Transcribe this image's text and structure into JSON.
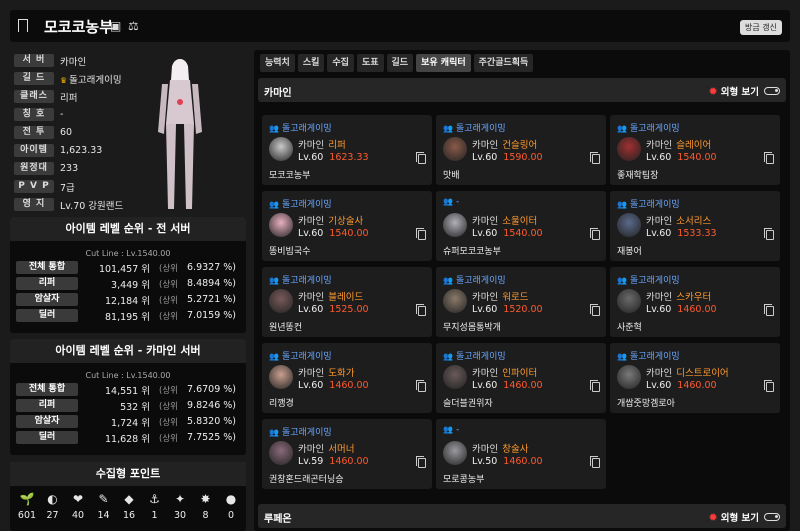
{
  "header": {
    "title": "모코코농부",
    "refresh_label": "방금 갱신"
  },
  "profile": {
    "rows": [
      {
        "label": "서 버",
        "value": "카마인"
      },
      {
        "label": "길 드",
        "value": "돌고래게이밍",
        "crown": true
      },
      {
        "label": "클래스",
        "value": "리퍼"
      },
      {
        "label": "칭 호",
        "value": "-"
      },
      {
        "label": "전 투",
        "value": "60"
      },
      {
        "label": "아이템",
        "value": "1,623.33"
      },
      {
        "label": "원정대",
        "value": "233"
      },
      {
        "label": "P V P",
        "value": "7급"
      },
      {
        "label": "영 지",
        "value": "Lv.70 강원랜드"
      }
    ]
  },
  "rank_all": {
    "title": "아이템 레벨 순위 - 전 서버",
    "cutline": "Cut Line : Lv.1540.00",
    "rows": [
      {
        "label": "전체 통합",
        "value": "101,457 위",
        "unit": "(상위",
        "pct": "6.9327 %)"
      },
      {
        "label": "리퍼",
        "value": "3,449 위",
        "unit": "(상위",
        "pct": "8.4894 %)"
      },
      {
        "label": "암살자",
        "value": "12,184 위",
        "unit": "(상위",
        "pct": "5.2721 %)"
      },
      {
        "label": "딜러",
        "value": "81,195 위",
        "unit": "(상위",
        "pct": "7.0159 %)"
      }
    ]
  },
  "rank_server": {
    "title": "아이템 레벨 순위 - 카마인 서버",
    "cutline": "Cut Line : Lv.1540.00",
    "rows": [
      {
        "label": "전체 통합",
        "value": "14,551 위",
        "unit": "(상위",
        "pct": "7.6709 %)"
      },
      {
        "label": "리퍼",
        "value": "532 위",
        "unit": "(상위",
        "pct": "9.8246 %)"
      },
      {
        "label": "암살자",
        "value": "1,724 위",
        "unit": "(상위",
        "pct": "5.8320 %)"
      },
      {
        "label": "딜러",
        "value": "11,628 위",
        "unit": "(상위",
        "pct": "7.7525 %)"
      }
    ]
  },
  "collection": {
    "title": "수집형 포인트",
    "items": [
      {
        "icon": "mokoko-seed-icon",
        "glyph": "🌱",
        "value": "601"
      },
      {
        "icon": "island-heart-icon",
        "glyph": "◐",
        "value": "27"
      },
      {
        "icon": "giant-heart-icon",
        "glyph": "❤",
        "value": "40"
      },
      {
        "icon": "art-icon",
        "glyph": "✎",
        "value": "14"
      },
      {
        "icon": "ignea-token-icon",
        "glyph": "◆",
        "value": "16"
      },
      {
        "icon": "voyage-icon",
        "glyph": "⚓",
        "value": "1"
      },
      {
        "icon": "world-tree-leaf-icon",
        "glyph": "✦",
        "value": "30"
      },
      {
        "icon": "star-icon",
        "glyph": "✸",
        "value": "8"
      },
      {
        "icon": "orpheus-star-icon",
        "glyph": "●",
        "value": "0"
      }
    ]
  },
  "tabs": [
    {
      "label": "능력치"
    },
    {
      "label": "스킬"
    },
    {
      "label": "수집"
    },
    {
      "label": "도표"
    },
    {
      "label": "길드"
    },
    {
      "label": "보유 캐릭터",
      "active": true
    },
    {
      "label": "주간골드획득"
    }
  ],
  "view_label": "외형 보기",
  "servers": [
    {
      "name": "카마인",
      "characters": [
        {
          "guild": "돌고래게이밍",
          "server": "카마인",
          "cls": "리퍼",
          "level": "Lv.60",
          "ilvl": "1623.33",
          "name": "모코코농부",
          "avatar": "#c9c9c9"
        },
        {
          "guild": "돌고래게이밍",
          "server": "카마인",
          "cls": "건슬링어",
          "level": "Lv.60",
          "ilvl": "1590.00",
          "name": "맛배",
          "avatar": "#8a5a4a"
        },
        {
          "guild": "돌고래게이밍",
          "server": "카마인",
          "cls": "슬레이어",
          "level": "Lv.60",
          "ilvl": "1540.00",
          "name": "좋재학팀장",
          "avatar": "#a03030"
        },
        {
          "guild": "돌고래게이밍",
          "server": "카마인",
          "cls": "기상술사",
          "level": "Lv.60",
          "ilvl": "1540.00",
          "name": "똥비빔국수",
          "avatar": "#e8b0c0"
        },
        {
          "guild": "-",
          "server": "카마인",
          "cls": "소울이터",
          "level": "Lv.60",
          "ilvl": "1540.00",
          "name": "슈퍼모코코농부",
          "avatar": "#b0b0b8"
        },
        {
          "guild": "돌고래게이밍",
          "server": "카마인",
          "cls": "소서리스",
          "level": "Lv.60",
          "ilvl": "1533.33",
          "name": "재봉어",
          "avatar": "#5a6a8a"
        },
        {
          "guild": "돌고래게이밍",
          "server": "카마인",
          "cls": "블레이드",
          "level": "Lv.60",
          "ilvl": "1525.00",
          "name": "원년똥컨",
          "avatar": "#7a5a5a"
        },
        {
          "guild": "돌고래게이밍",
          "server": "카마인",
          "cls": "워로드",
          "level": "Lv.60",
          "ilvl": "1520.00",
          "name": "무지성몸통박개",
          "avatar": "#8a7a6a"
        },
        {
          "guild": "돌고래게이밍",
          "server": "카마인",
          "cls": "스카우터",
          "level": "Lv.60",
          "ilvl": "1460.00",
          "name": "사준혁",
          "avatar": "#6a6a6a"
        },
        {
          "guild": "돌고래게이밍",
          "server": "카마인",
          "cls": "도화가",
          "level": "Lv.60",
          "ilvl": "1460.00",
          "name": "리깽경",
          "avatar": "#caa090"
        },
        {
          "guild": "돌고래게이밍",
          "server": "카마인",
          "cls": "인파이터",
          "level": "Lv.60",
          "ilvl": "1460.00",
          "name": "슬더블권위자",
          "avatar": "#6a5a5a"
        },
        {
          "guild": "돌고래게이밍",
          "server": "카마인",
          "cls": "디스트로이어",
          "level": "Lv.60",
          "ilvl": "1460.00",
          "name": "개쌉줏망겜로아",
          "avatar": "#7a7a7a"
        },
        {
          "guild": "돌고래게이밍",
          "server": "카마인",
          "cls": "서머너",
          "level": "Lv.59",
          "ilvl": "1460.00",
          "name": "권창혼드래곤터닝승",
          "avatar": "#8a6a7a"
        },
        {
          "guild": "-",
          "server": "카마인",
          "cls": "창술사",
          "level": "Lv.50",
          "ilvl": "1460.00",
          "name": "모로콩농부",
          "avatar": "#9a9aa0"
        }
      ]
    },
    {
      "name": "루페온",
      "characters": []
    }
  ],
  "colors": {
    "accent_blue": "#6aa7ff",
    "class_orange": "#ff9a2e",
    "ilvl_red": "#ff5a2e",
    "crown": "#f0b400"
  }
}
